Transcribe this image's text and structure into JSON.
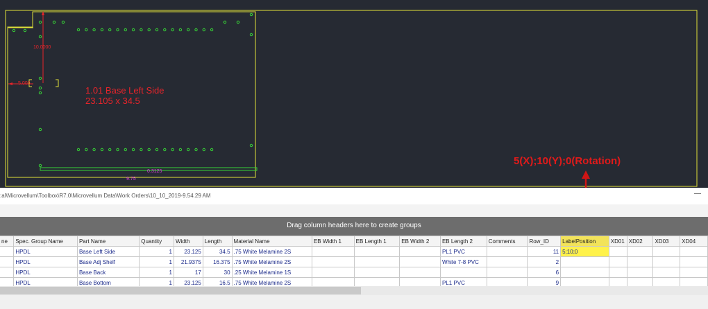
{
  "cad": {
    "part_label_line1": "1.01 Base Left Side",
    "part_label_line2": "23.105 x 34.5",
    "dim_vertical": "10.0000",
    "dim_horizontal": "5.000",
    "dim_bottom_1": "0.3125",
    "dim_bottom_2": "9.75",
    "colors": {
      "background": "#262a33",
      "outline": "#e3e33a",
      "bore": "#37d437",
      "dim": "#e8242a",
      "dim2": "#e040e0"
    }
  },
  "annotation": {
    "text": "5(X);10(Y);0(Rotation)",
    "color": "#e11a1a"
  },
  "window": {
    "path": ":al\\Microvellum\\Toolbox\\R7.0\\Microvellum Data\\Work Orders\\10_10_2019-9.54.29 AM",
    "minimize": "—"
  },
  "grid": {
    "group_hint": "Drag column headers here to create groups",
    "columns": [
      "ne",
      "Spec. Group Name",
      "Part Name",
      "Quantity",
      "Width",
      "Length",
      "Material Name",
      "EB Width 1",
      "EB Length 1",
      "EB Width 2",
      "EB Length 2",
      "Comments",
      "Row_ID",
      "LabelPosition",
      "XD01",
      "XD02",
      "XD03",
      "XD04"
    ],
    "rows": [
      [
        "",
        "HPDL",
        "Base Left Side",
        "1",
        "23.125",
        "34.5",
        ".75 White Melamine 2S",
        "",
        "",
        "",
        "PL1 PVC",
        "",
        "11",
        "5;10;0",
        "",
        "",
        "",
        ""
      ],
      [
        "",
        "HPDL",
        "Base Adj Shelf",
        "1",
        "21.9375",
        "16.375",
        ".75 White Melamine 2S",
        "",
        "",
        "",
        "White 7-8 PVC",
        "",
        "2",
        "",
        "",
        "",
        "",
        ""
      ],
      [
        "",
        "HPDL",
        "Base Back",
        "1",
        "17",
        "30",
        ".25 White Melamine 1S",
        "",
        "",
        "",
        "",
        "",
        "6",
        "",
        "",
        "",
        "",
        ""
      ],
      [
        "",
        "HPDL",
        "Base Bottom",
        "1",
        "23.125",
        "16.5",
        ".75 White Melamine 2S",
        "",
        "",
        "",
        "PL1 PVC",
        "",
        "9",
        "",
        "",
        "",
        "",
        ""
      ]
    ]
  }
}
